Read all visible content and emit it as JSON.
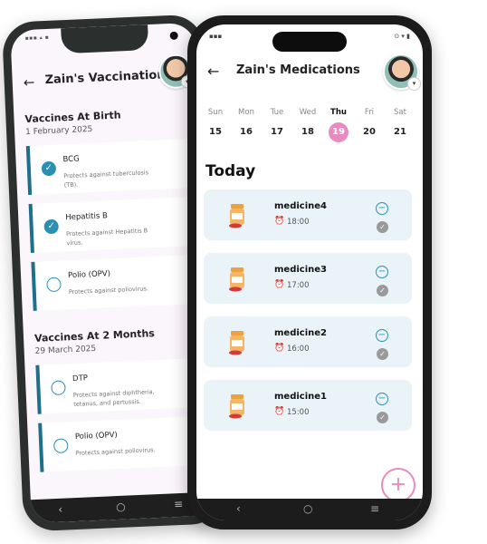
{
  "vaccinations": {
    "status_bar": "▪▪▪ ▴ ▪",
    "title": "Zain's Vaccinations",
    "back_icon": "back-arrow-icon",
    "sections": [
      {
        "title": "Vaccines At Birth",
        "date": "1 February 2025",
        "items": [
          {
            "name": "BCG",
            "description": "Protects against tuberculosis (TB).",
            "done": true
          },
          {
            "name": "Hepatitis B",
            "description": "Protects against Hepatitis B virus.",
            "done": true
          },
          {
            "name": "Polio (OPV)",
            "description": "Protects against poliovirus.",
            "done": false
          }
        ]
      },
      {
        "title": "Vaccines At 2 Months",
        "date": "29 March 2025",
        "items": [
          {
            "name": "DTP",
            "description": "Protects against diphtheria, tetanus, and pertussis.",
            "done": false
          },
          {
            "name": "Polio (OPV)",
            "description": "Protects against poliovirus.",
            "done": false
          }
        ]
      }
    ],
    "nav": {
      "back": "‹",
      "home": "○",
      "menu": "≡"
    }
  },
  "medications": {
    "status_left": "▪▪▪",
    "status_right": "⊙ ▾ ▮",
    "title": "Zain's Medications",
    "back_icon": "back-arrow-icon",
    "week": [
      {
        "name": "Sun",
        "num": "15"
      },
      {
        "name": "Mon",
        "num": "16"
      },
      {
        "name": "Tue",
        "num": "17"
      },
      {
        "name": "Wed",
        "num": "18"
      },
      {
        "name": "Thu",
        "num": "19"
      },
      {
        "name": "Fri",
        "num": "20"
      },
      {
        "name": "Sat",
        "num": "21"
      }
    ],
    "active_day": "19",
    "today_label": "Today",
    "items": [
      {
        "name": "medicine4",
        "time": "18:00"
      },
      {
        "name": "medicine3",
        "time": "17:00"
      },
      {
        "name": "medicine2",
        "time": "16:00"
      },
      {
        "name": "medicine1",
        "time": "15:00"
      }
    ],
    "fab_label": "+",
    "nav": {
      "back": "‹",
      "home": "○",
      "menu": "≡"
    },
    "accent_color": "#e98bc0",
    "card_color": "#e9f3f8"
  }
}
